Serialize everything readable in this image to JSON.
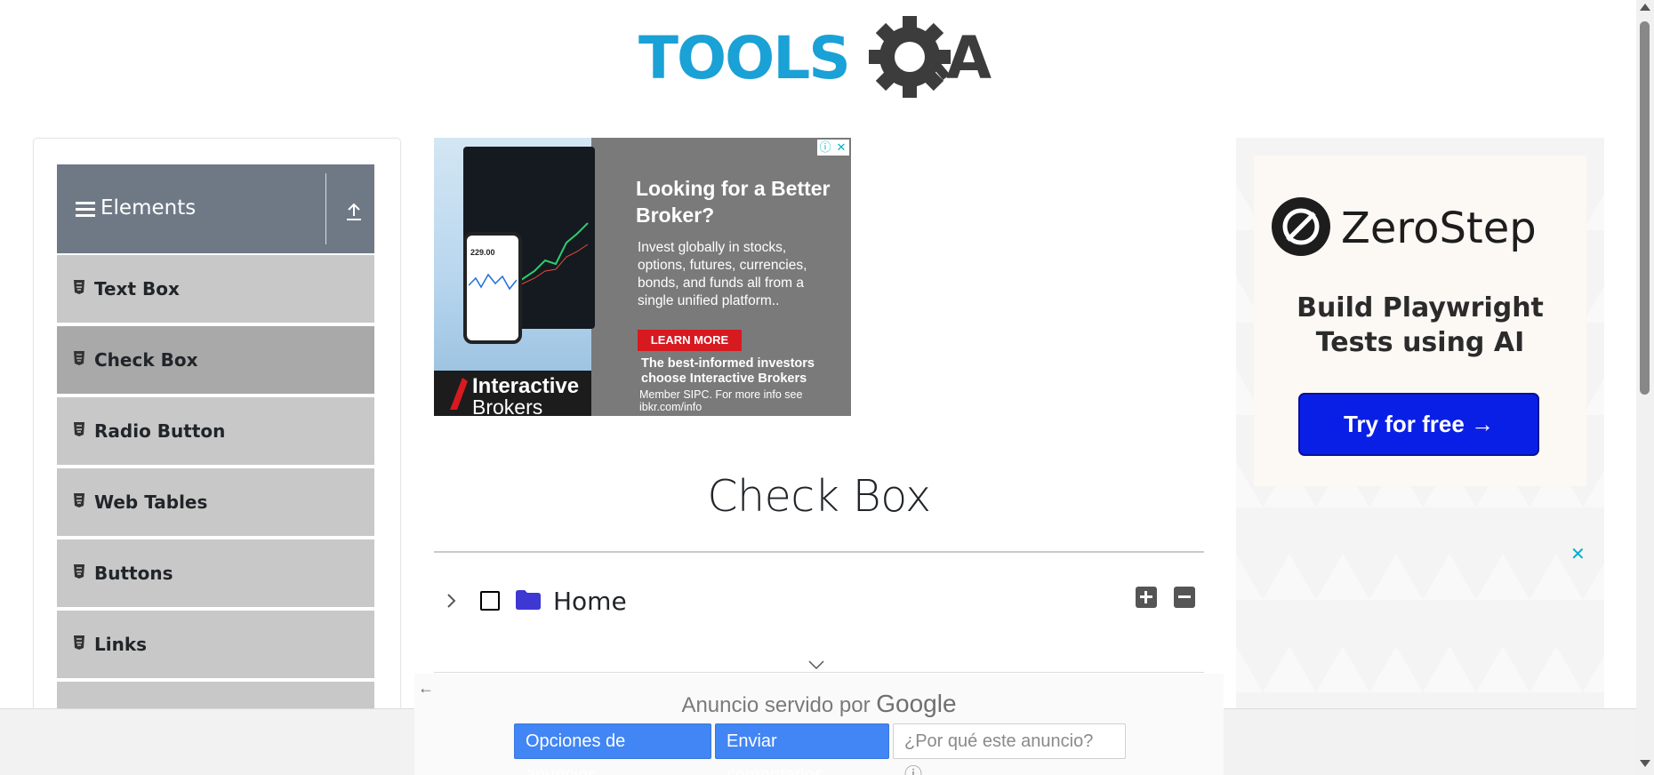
{
  "logo": {
    "text_left": "TOOLS",
    "text_right": "A"
  },
  "sidebar": {
    "group_title": "Elements",
    "items": [
      {
        "label": "Text Box",
        "active": false
      },
      {
        "label": "Check Box",
        "active": true
      },
      {
        "label": "Radio Button",
        "active": false
      },
      {
        "label": "Web Tables",
        "active": false
      },
      {
        "label": "Buttons",
        "active": false
      },
      {
        "label": "Links",
        "active": false
      }
    ]
  },
  "ad_center": {
    "headline": "Looking for a Better Broker?",
    "body": "Invest globally in stocks, options, futures, currencies, bonds, and funds all from a single unified platform..",
    "cta": "LEARN MORE",
    "tagline": "The best-informed investors choose Interactive Brokers",
    "fine_print": "Member SIPC. For more info see ibkr.com/info",
    "brand_line1": "Interactive",
    "brand_line2": "Brokers",
    "phone_value": "229.00"
  },
  "main": {
    "title": "Check Box",
    "tree": {
      "root_label": "Home",
      "checked": false,
      "expanded": false
    }
  },
  "ad_right": {
    "brand": "ZeroStep",
    "pitch": "Build Playwright Tests using AI",
    "cta": "Try for free →",
    "close": "✕"
  },
  "google_feedback": {
    "served_by": "Anuncio servido por",
    "google": "Google",
    "options": "Opciones de anuncios",
    "send_feedback": "Enviar comentarios",
    "why": "¿Por qué este anuncio? ⓘ",
    "back": "←"
  },
  "colors": {
    "logo_blue": "#1aa1d6",
    "logo_dark": "#3c3c3c",
    "sidebar_header": "#6f7986",
    "sidebar_item": "#c8c8c8",
    "sidebar_active": "#a9a9a9",
    "folder": "#3d37d4",
    "cta_blue": "#0a1fe6",
    "google_blue": "#4285f4"
  }
}
